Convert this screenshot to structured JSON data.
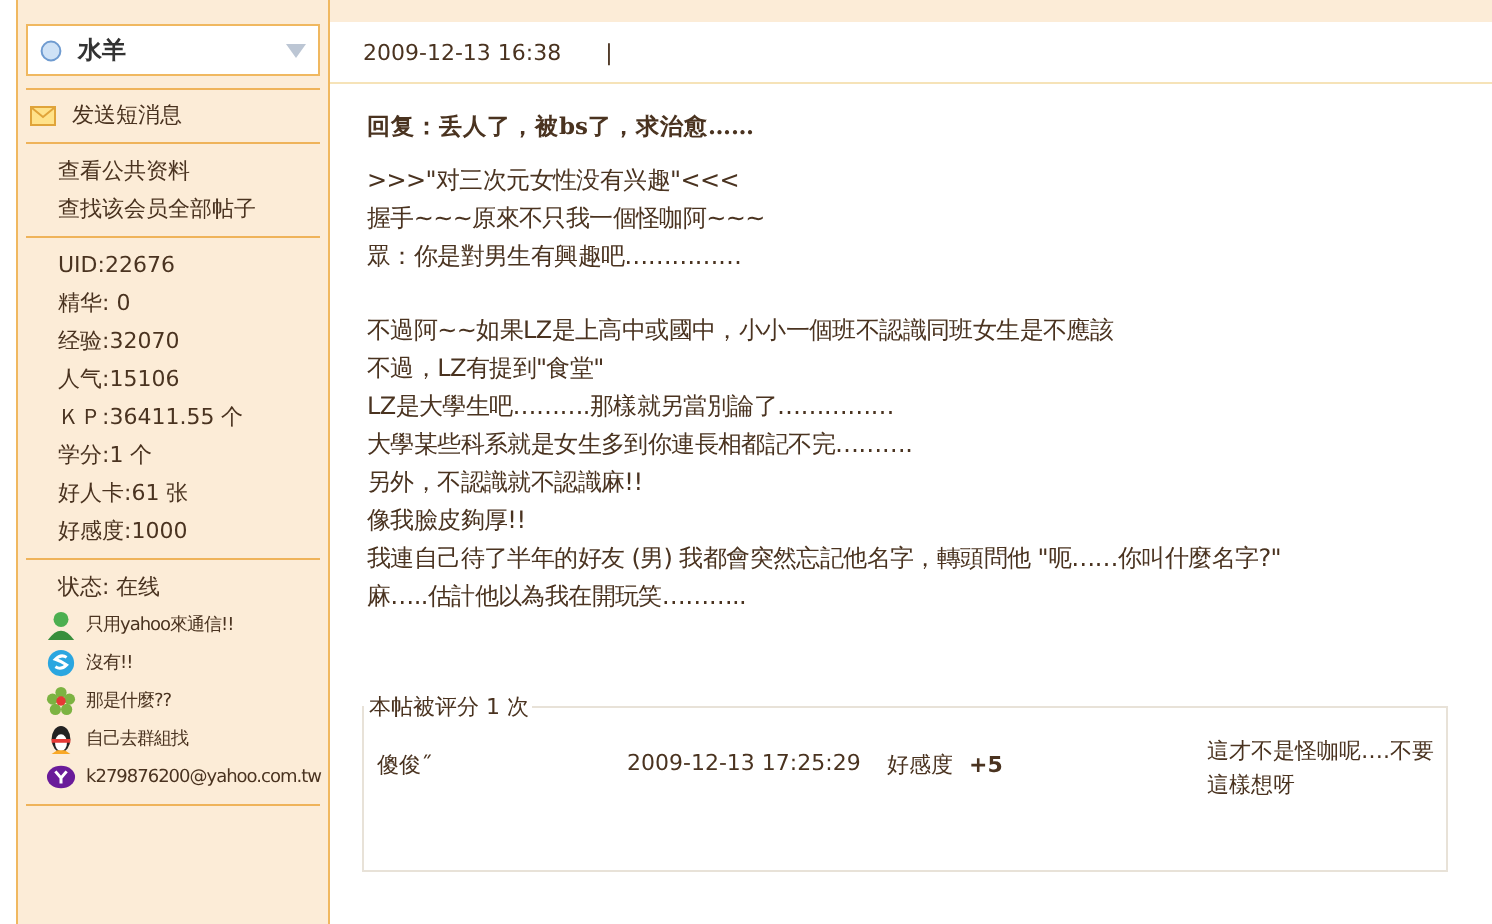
{
  "sidebar": {
    "username": "水羊",
    "send_message": "发送短消息",
    "links": [
      "查看公共资料",
      "查找该会员全部帖子"
    ],
    "stats": [
      "UID:22676",
      "精华: 0",
      "经验:32070",
      "人气:15106",
      "ＫＰ:36411.55 个",
      "学分:1 个",
      "好人卡:61 张",
      "好感度:1000"
    ],
    "status": "状态: 在线",
    "contacts": [
      {
        "kind": "person",
        "text": "只用yahoo來通信!!"
      },
      {
        "kind": "skype",
        "text": "沒有!!"
      },
      {
        "kind": "flower",
        "text": "那是什麼??"
      },
      {
        "kind": "penguin",
        "text": "自己去群組找"
      },
      {
        "kind": "yahoo",
        "text": "k279876200@yahoo.com.tw"
      }
    ]
  },
  "post": {
    "date": "2009-12-13 16:38",
    "separator": "|",
    "title": "回复：丢人了，被bs了，求治愈……",
    "paragraphs": [
      [
        ">>>\"对三次元女性没有兴趣\"<<<",
        "握手~~~原來不只我一個怪咖阿~~~",
        "眾：你是對男生有興趣吧……………"
      ],
      [
        "不過阿~~如果LZ是上高中或國中，小小一個班不認識同班女生是不應該",
        "不過，LZ有提到\"食堂\"",
        "LZ是大學生吧……….那樣就另當別論了……………",
        "大學某些科系就是女生多到你連長相都記不完……….",
        "另外，不認識就不認識麻!!",
        "像我臉皮夠厚!!",
        "我連自己待了半年的好友 (男) 我都會突然忘記他名字，轉頭問他 \"呃……你叫什麼名字?\"",
        "麻…..估計他以為我在開玩笑……….."
      ]
    ]
  },
  "rating": {
    "legend": "本帖被评分 1 次",
    "rows": [
      {
        "user": "傻俊˝",
        "time": "2009-12-13 17:25:29",
        "field": "好感度",
        "score": "+5",
        "comment": "這才不是怪咖呢….不要這樣想呀"
      }
    ]
  }
}
